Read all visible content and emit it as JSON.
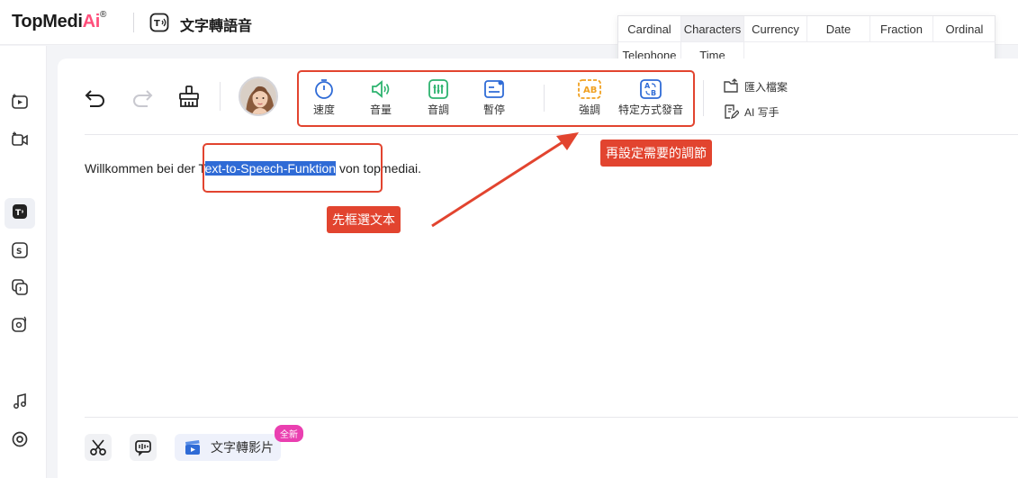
{
  "header": {
    "logo_text": "TopMedi",
    "logo_ai": "Ai",
    "logo_reg": "®",
    "page_title": "文字轉語音"
  },
  "toolbar": {
    "tools": [
      {
        "label": "速度",
        "icon": "timer-icon"
      },
      {
        "label": "音量",
        "icon": "volume-icon"
      },
      {
        "label": "音調",
        "icon": "equalizer-icon"
      },
      {
        "label": "暫停",
        "icon": "pause-text-icon"
      },
      {
        "label": "強調",
        "icon": "emphasis-ab-icon"
      },
      {
        "label": "特定方式發音",
        "icon": "pronunciation-ab-icon"
      }
    ],
    "import_label": "匯入檔案",
    "ai_write_label": "AI 写手"
  },
  "editor": {
    "text_before": "Willkommen bei der T",
    "text_selected": "ext-to-Speech-Funktion",
    "text_after": " von topmediai."
  },
  "annotations": {
    "step1": "先框選文本",
    "step2": "再設定需要的調節"
  },
  "popup": {
    "row1": [
      "Cardinal",
      "Characters",
      "Currency",
      "Date",
      "Fraction",
      "Ordinal"
    ],
    "row2": [
      "Telephone",
      "Time"
    ],
    "highlighted": "Characters"
  },
  "bottom_bar": {
    "video_label": "文字轉影片",
    "new_badge": "全新"
  },
  "colors": {
    "accent_red": "#e2442f",
    "selection_blue": "#2f6bd6",
    "logo_pink": "#ff4f7b",
    "badge_pink": "#ea3fb0"
  }
}
